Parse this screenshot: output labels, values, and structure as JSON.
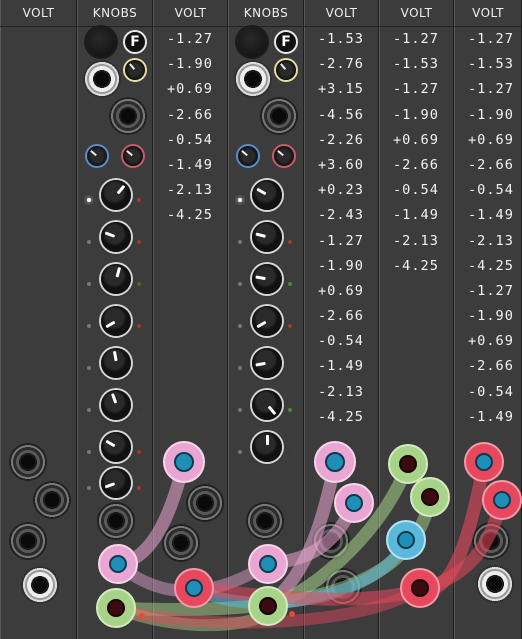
{
  "modules": [
    {
      "title": "VOLT"
    },
    {
      "title": "KNOBS"
    },
    {
      "title": "VOLT",
      "values": [
        "-1.27",
        "-1.90",
        "+0.69",
        "-2.66",
        "-0.54",
        "-1.49",
        "-2.13",
        "-4.25"
      ]
    },
    {
      "title": "KNOBS"
    },
    {
      "title": "VOLT",
      "values": [
        "-1.53",
        "-2.76",
        "+3.15",
        "-4.56",
        "-2.26",
        "+3.60",
        "+0.23",
        "-2.43",
        "-1.27",
        "-1.90",
        "+0.69",
        "-2.66",
        "-0.54",
        "-1.49",
        "-2.13",
        "-4.25"
      ]
    },
    {
      "title": "VOLT",
      "values": [
        "-1.27",
        "-1.53",
        "-1.27",
        "-1.90",
        "+0.69",
        "-2.66",
        "-0.54",
        "-1.49",
        "-2.13",
        "-4.25"
      ]
    },
    {
      "title": "VOLT",
      "values": [
        "-1.27",
        "-1.53",
        "-1.27",
        "-1.90",
        "+0.69",
        "-2.66",
        "-0.54",
        "-1.49",
        "-2.13",
        "-4.25",
        "-1.27",
        "-1.90",
        "+0.69",
        "-2.66",
        "-0.54",
        "-1.49"
      ]
    }
  ],
  "function_button_label": "F",
  "colors": {
    "panel": "#3c3c3c",
    "cable_pink": "#e9a6d2",
    "cable_red": "#e8485e",
    "cable_green": "#a8d48a",
    "cable_blue": "#5ab8dc",
    "cable_plug_teal": "#1f8fb8"
  }
}
